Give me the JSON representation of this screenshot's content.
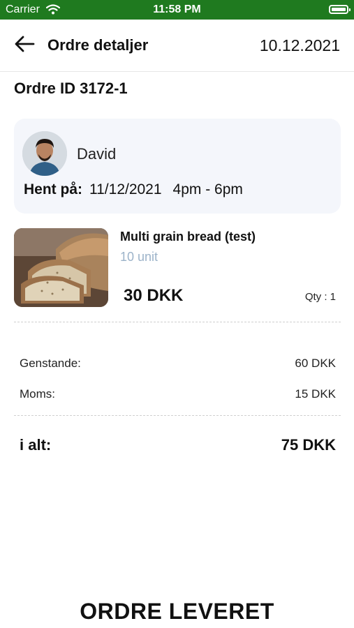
{
  "status_bar": {
    "carrier": "Carrier",
    "time": "11:58 PM"
  },
  "header": {
    "title": "Ordre detaljer",
    "date": "10.12.2021"
  },
  "order": {
    "id_label": "Ordre ID 3172-1"
  },
  "customer": {
    "name": "David",
    "pickup_label": "Hent på:",
    "pickup_date": "11/12/2021",
    "pickup_time": "4pm - 6pm"
  },
  "product": {
    "name": "Multi grain bread (test)",
    "unit": "10 unit",
    "price": "30 DKK",
    "qty": "Qty : 1"
  },
  "summary": {
    "items_label": "Genstande:",
    "items_value": "60 DKK",
    "tax_label": "Moms:",
    "tax_value": "15 DKK",
    "total_label": "i alt:",
    "total_value": "75 DKK"
  },
  "footer": {
    "status": "ORDRE LEVERET"
  },
  "colors": {
    "status_bar": "#1f7a1f",
    "card_bg": "#f4f6fb",
    "unit_text": "#9cb3c9"
  }
}
